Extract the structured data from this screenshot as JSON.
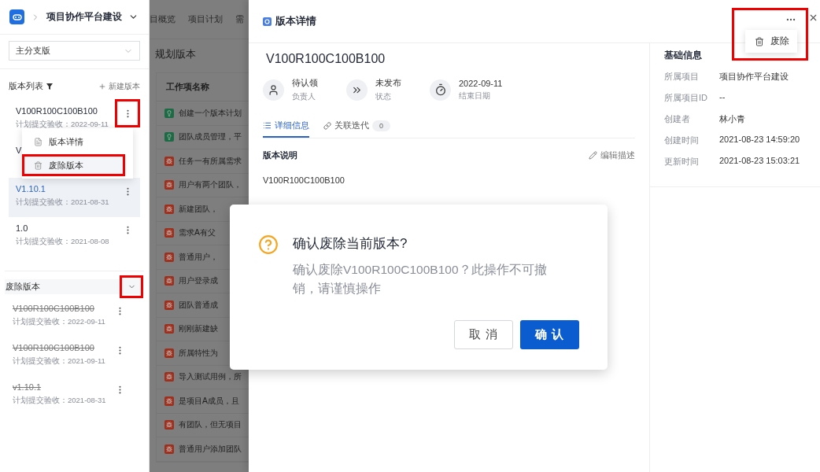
{
  "sidebar": {
    "project": "项目协作平台建设",
    "branch_select": {
      "value": "主分支版"
    },
    "list_title": "版本列表",
    "new_button": "新建版本",
    "versions": [
      {
        "name": "V100R100C100B100",
        "date": "计划提交验收：2022-09-11",
        "selected": false,
        "highlighted": true
      },
      {
        "name": "V",
        "selected": false
      },
      {
        "name": "V1.10.1",
        "date": "计划提交验收：2021-08-31",
        "selected": true,
        "highlighted": false
      },
      {
        "name": "1.0",
        "date": "计划提交验收：2021-08-08",
        "selected": false,
        "highlighted": false
      }
    ],
    "version_menu": {
      "open": true,
      "items": [
        {
          "label": "版本详情",
          "kind": "detail",
          "highlighted": false
        },
        {
          "label": "废除版本",
          "kind": "delete",
          "highlighted": true
        }
      ]
    },
    "deprecated": {
      "title": "废除版本",
      "expanded": true,
      "highlighted": true,
      "items": [
        {
          "name": "V100R100C100B100",
          "date": "计划提交验收：2022-09-11"
        },
        {
          "name": "V100R100C100B100",
          "date": "计划提交验收：2021-09-11"
        },
        {
          "name": "v1.10.1",
          "date": "计划提交验收：2021-08-31"
        }
      ]
    }
  },
  "background_page": {
    "tabs": [
      "目概览",
      "项目计划",
      "需"
    ],
    "title": "规划版本",
    "column": "工作项名称",
    "rows": [
      {
        "kind": "idea",
        "text": "创建一个版本计划"
      },
      {
        "kind": "idea",
        "text": "团队成员管理，平"
      },
      {
        "kind": "issue",
        "text": "任务一有所属需求"
      },
      {
        "kind": "issue",
        "text": "用户有两个团队，"
      },
      {
        "kind": "issue",
        "text": "新建团队，"
      },
      {
        "kind": "issue",
        "text": "需求A有父"
      },
      {
        "kind": "issue",
        "text": "普通用户，"
      },
      {
        "kind": "issue",
        "text": "用户登录成"
      },
      {
        "kind": "issue",
        "text": "团队普通成"
      },
      {
        "kind": "issue",
        "text": "刚刚新建缺"
      },
      {
        "kind": "issue",
        "text": "所属特性为"
      },
      {
        "kind": "issue",
        "text": "导入测试用例，所"
      },
      {
        "kind": "issue",
        "text": "是项目A成员，且"
      },
      {
        "kind": "issue",
        "text": "有团队，但无项目"
      },
      {
        "kind": "issue",
        "text": "普通用户添加团队"
      }
    ]
  },
  "drawer": {
    "title": "版本详情",
    "more_menu": {
      "open": true,
      "highlighted": true,
      "items": [
        {
          "label": "废除",
          "kind": "delete"
        }
      ]
    },
    "version_name": "V100R100C100B100",
    "meta": [
      {
        "kind": "owner",
        "value": "待认领",
        "label": "负责人"
      },
      {
        "kind": "status",
        "value": "未发布",
        "label": "状态"
      },
      {
        "kind": "date",
        "value": "2022-09-11",
        "label": "结束日期"
      }
    ],
    "tabs": [
      {
        "label": "详细信息",
        "kind": "list",
        "selected": true
      },
      {
        "label": "关联迭代",
        "kind": "link",
        "count": "0",
        "selected": false
      }
    ],
    "description": {
      "title": "版本说明",
      "edit": "编辑描述",
      "text": "V100R100C100B100"
    },
    "info": {
      "title": "基础信息",
      "rows": [
        {
          "label": "所属项目",
          "value": "项目协作平台建设"
        },
        {
          "label": "所属项目ID",
          "value": "--"
        },
        {
          "label": "创建者",
          "value": "林小青"
        },
        {
          "label": "创建时间",
          "value": "2021-08-23 14:59:20"
        },
        {
          "label": "更新时间",
          "value": "2021-08-23 15:03:21"
        }
      ]
    }
  },
  "dialog": {
    "title": "确认废除当前版本?",
    "message": "确认废除V100R100C100B100？此操作不可撤销，请谨慎操作",
    "buttons": [
      {
        "label": "取 消",
        "kind": "secondary"
      },
      {
        "label": "确 认",
        "kind": "primary"
      }
    ]
  }
}
